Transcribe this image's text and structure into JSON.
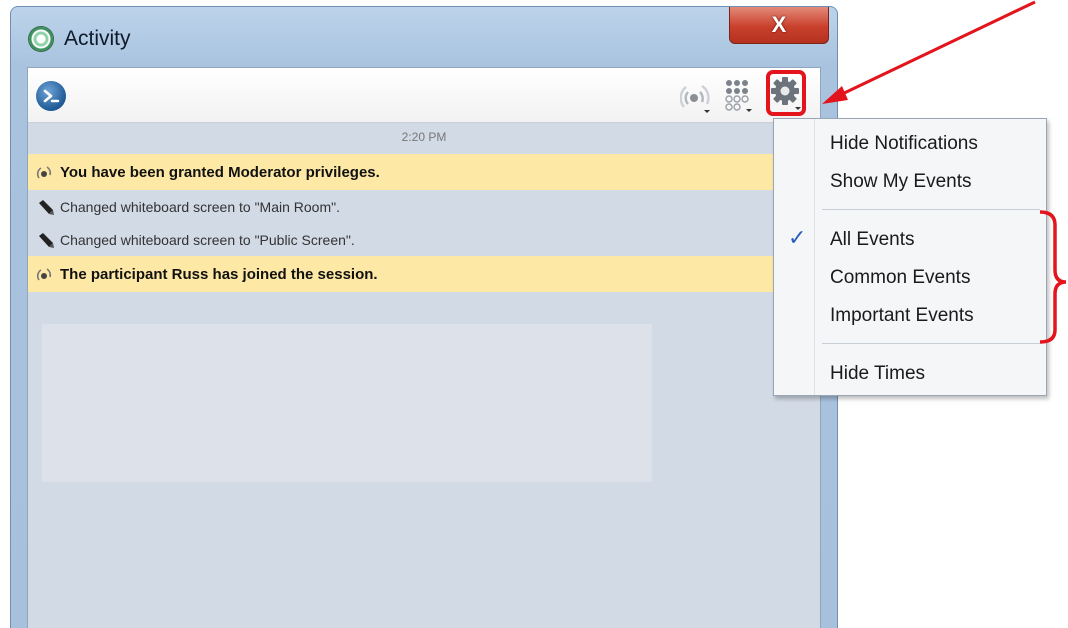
{
  "window": {
    "title": "Activity",
    "close_label": "X"
  },
  "toolbar": {
    "icons": [
      "prompt-icon",
      "broadcast-icon",
      "dot-grid-icon",
      "gear-icon"
    ]
  },
  "activity": {
    "time": "2:20 PM",
    "events": [
      {
        "text": "You have been granted Moderator privileges.",
        "important": true,
        "icon": "broadcast-icon"
      },
      {
        "text": "Changed whiteboard screen to \"Main Room\".",
        "important": false,
        "icon": "marker-icon"
      },
      {
        "text": "Changed whiteboard screen to \"Public Screen\".",
        "important": false,
        "icon": "marker-icon"
      },
      {
        "text": "The participant Russ has joined the session.",
        "important": true,
        "icon": "broadcast-icon"
      }
    ]
  },
  "menu": {
    "hide_notifications": "Hide Notifications",
    "show_my_events": "Show My Events",
    "all_events": "All Events",
    "common_events": "Common Events",
    "important_events": "Important Events",
    "hide_times": "Hide Times",
    "checked": "All Events"
  },
  "colors": {
    "annotation": "#e3141b",
    "highlight_row": "#fde9a5",
    "check": "#2d5fbd"
  }
}
